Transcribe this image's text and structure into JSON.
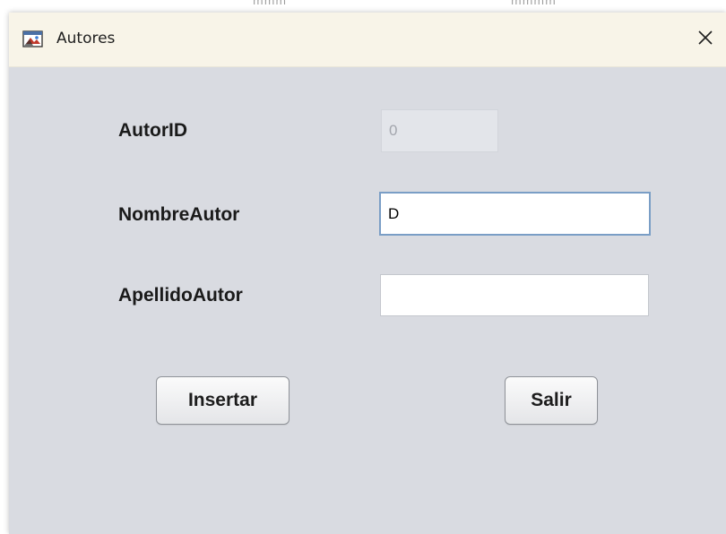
{
  "background": {
    "fragments": [
      "mmm",
      "mmmm"
    ]
  },
  "window": {
    "title": "Autores",
    "close_symbol": "✕",
    "icon": "app-window-icon"
  },
  "form": {
    "fields": [
      {
        "label": "AutorID",
        "value": "0",
        "placeholder": "",
        "state": "disabled"
      },
      {
        "label": "NombreAutor",
        "value": "D",
        "placeholder": "",
        "state": "focused"
      },
      {
        "label": "ApellidoAutor",
        "value": "",
        "placeholder": "",
        "state": "normal"
      }
    ]
  },
  "buttons": {
    "insert_label": "Insertar",
    "exit_label": "Salir"
  },
  "colors": {
    "window_bg": "#d9dbe1",
    "titlebar_bg": "#f8f4e8",
    "focus_border": "#7a9ec6"
  }
}
